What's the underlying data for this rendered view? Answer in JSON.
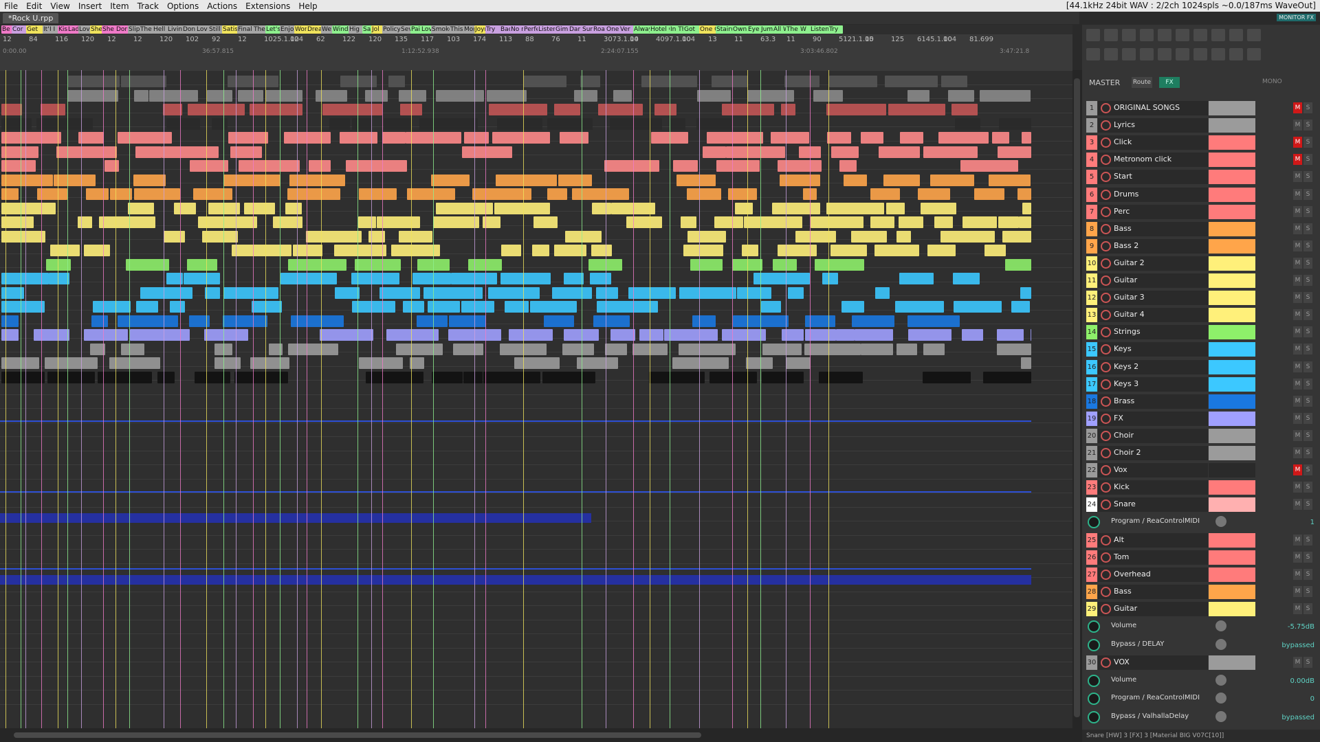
{
  "menu": {
    "items": [
      "File",
      "Edit",
      "View",
      "Insert",
      "Item",
      "Track",
      "Options",
      "Actions",
      "Extensions",
      "Help"
    ],
    "status": "[44.1kHz 24bit WAV : 2/2ch 1024spls ~0.0/187ms WaveOut]"
  },
  "project_tab": "*Rock U.rpp",
  "monitor_fx_label": "MONITOR FX",
  "master": {
    "label": "MASTER",
    "route": "Route",
    "fx": "FX",
    "mono": "MONO"
  },
  "regions": [
    {
      "label": "Be",
      "color": "#f07ac8"
    },
    {
      "label": "Cor",
      "color": "#c9a0e0"
    },
    {
      "label": "Get",
      "color": "#f0e35c"
    },
    {
      "label": "It's",
      "color": "#a6a6a6"
    },
    {
      "label": "I I",
      "color": "#a6a6a6"
    },
    {
      "label": "Kis",
      "color": "#f07ac8"
    },
    {
      "label": "Lad",
      "color": "#f07ac8"
    },
    {
      "label": "Lov",
      "color": "#a6a6a6"
    },
    {
      "label": "She",
      "color": "#f0e35c"
    },
    {
      "label": "She",
      "color": "#f07ac8"
    },
    {
      "label": "Dor",
      "color": "#f07ac8"
    },
    {
      "label": "Slip",
      "color": "#a6a6a6"
    },
    {
      "label": "The",
      "color": "#a6a6a6"
    },
    {
      "label": "Hell",
      "color": "#a6a6a6"
    },
    {
      "label": "Livin",
      "color": "#a6a6a6"
    },
    {
      "label": "Don't",
      "color": "#a6a6a6"
    },
    {
      "label": "Lov",
      "color": "#a6a6a6"
    },
    {
      "label": "Still",
      "color": "#a6a6a6"
    },
    {
      "label": "Satis",
      "color": "#f0e35c"
    },
    {
      "label": "Final",
      "color": "#a6a6a6"
    },
    {
      "label": "The",
      "color": "#a6a6a6"
    },
    {
      "label": "Let's",
      "color": "#8ef08e"
    },
    {
      "label": "Enjo",
      "color": "#a6a6a6"
    },
    {
      "label": "Won",
      "color": "#f0e35c"
    },
    {
      "label": "Drea",
      "color": "#f0e35c"
    },
    {
      "label": "We",
      "color": "#a6a6a6"
    },
    {
      "label": "Wind",
      "color": "#8ef08e"
    },
    {
      "label": "Hig",
      "color": "#a6a6a6"
    },
    {
      "label": "Sam",
      "color": "#8ef08e"
    },
    {
      "label": "Jol",
      "color": "#f0e35c"
    },
    {
      "label": "Policy",
      "color": "#a6a6a6"
    },
    {
      "label": "Sev",
      "color": "#a6a6a6"
    },
    {
      "label": "Pai",
      "color": "#8ef08e"
    },
    {
      "label": "Lov",
      "color": "#8ef08e"
    },
    {
      "label": "Smoke",
      "color": "#a6a6a6"
    },
    {
      "label": "This",
      "color": "#a6a6a6"
    },
    {
      "label": "Mon",
      "color": "#a6a6a6"
    },
    {
      "label": "Joyr",
      "color": "#f0e35c"
    },
    {
      "label": "Try",
      "color": "#c9a0e0"
    },
    {
      "label": "Bac",
      "color": "#c9a0e0"
    },
    {
      "label": "No r",
      "color": "#c9a0e0"
    },
    {
      "label": "Perfe",
      "color": "#c9a0e0"
    },
    {
      "label": "Listen",
      "color": "#c9a0e0"
    },
    {
      "label": "Gimm",
      "color": "#c9a0e0"
    },
    {
      "label": "Dar",
      "color": "#c9a0e0"
    },
    {
      "label": "Sun",
      "color": "#c9a0e0"
    },
    {
      "label": "Roa",
      "color": "#c9a0e0"
    },
    {
      "label": "One",
      "color": "#c9a0e0"
    },
    {
      "label": "Ver",
      "color": "#c9a0e0"
    },
    {
      "label": "Always",
      "color": "#8ef08e"
    },
    {
      "label": "Hotel C",
      "color": "#8ef08e"
    },
    {
      "label": "In Th",
      "color": "#8ef08e"
    },
    {
      "label": "Got",
      "color": "#8ef08e"
    },
    {
      "label": "One O",
      "color": "#f0e35c"
    },
    {
      "label": "Stairw",
      "color": "#8ef08e"
    },
    {
      "label": "Own",
      "color": "#8ef08e"
    },
    {
      "label": "Eye o",
      "color": "#8ef08e"
    },
    {
      "label": "Jum",
      "color": "#8ef08e"
    },
    {
      "label": "All W",
      "color": "#8ef08e"
    },
    {
      "label": "The",
      "color": "#8ef08e"
    },
    {
      "label": "W",
      "color": "#8ef08e"
    },
    {
      "label": "Listen",
      "color": "#8ef08e"
    },
    {
      "label": "Try",
      "color": "#8ef08e"
    }
  ],
  "ruler": {
    "ticks": [
      "12",
      "84",
      "116",
      "120",
      "12",
      "12",
      "120",
      "102",
      "92",
      "12",
      "1025.1.00",
      "124",
      "62",
      "122",
      "120",
      "135",
      "117",
      "103",
      "174",
      "113",
      "88",
      "76",
      "11",
      "3073.1.00",
      "14",
      "4097.1.00",
      "104",
      "13",
      "11",
      "63.3",
      "11",
      "90",
      "5121.1.00",
      "15",
      "125",
      "6145.1.00",
      "104",
      "81.699"
    ],
    "times": [
      "0:00.00",
      "36:57.815",
      "1:12:52.938",
      "2:24:07.155",
      "3:03:46.802",
      "3:47:21.8"
    ]
  },
  "tracks": [
    {
      "num": "1",
      "name": "ORIGINAL SONGS",
      "color": "#9b9b9b",
      "mute": true,
      "numbg": "#9b9b9b"
    },
    {
      "num": "2",
      "name": "Lyrics",
      "color": "#9b9b9b",
      "mute": false,
      "numbg": "#9b9b9b"
    },
    {
      "num": "3",
      "name": "Click",
      "color": "#ff7b7b",
      "mute": true,
      "numbg": "#ff7b7b"
    },
    {
      "num": "4",
      "name": "Metronom click",
      "color": "#ff7b7b",
      "mute": true,
      "numbg": "#ff7b7b"
    },
    {
      "num": "5",
      "name": "Start",
      "color": "#ff7b7b",
      "mute": false,
      "numbg": "#ff7b7b"
    },
    {
      "num": "6",
      "name": "Drums",
      "color": "#ff7b7b",
      "mute": false,
      "numbg": "#ff7b7b"
    },
    {
      "num": "7",
      "name": "Perc",
      "color": "#ff7b7b",
      "mute": false,
      "numbg": "#ff7b7b"
    },
    {
      "num": "8",
      "name": "Bass",
      "color": "#ffa54a",
      "mute": false,
      "numbg": "#ffa54a"
    },
    {
      "num": "9",
      "name": "Bass 2",
      "color": "#ffa54a",
      "mute": false,
      "numbg": "#ffa54a"
    },
    {
      "num": "10",
      "name": "Guitar 2",
      "color": "#fff07a",
      "mute": false,
      "numbg": "#fff07a"
    },
    {
      "num": "11",
      "name": "Guitar",
      "color": "#fff07a",
      "mute": false,
      "numbg": "#fff07a"
    },
    {
      "num": "12",
      "name": "Guitar 3",
      "color": "#fff07a",
      "mute": false,
      "numbg": "#fff07a"
    },
    {
      "num": "13",
      "name": "Guitar 4",
      "color": "#fff07a",
      "mute": false,
      "numbg": "#fff07a"
    },
    {
      "num": "14",
      "name": "Strings",
      "color": "#8ef06a",
      "mute": false,
      "numbg": "#8ef06a"
    },
    {
      "num": "15",
      "name": "Keys",
      "color": "#3cc8ff",
      "mute": false,
      "numbg": "#3cc8ff"
    },
    {
      "num": "16",
      "name": "Keys 2",
      "color": "#3cc8ff",
      "mute": false,
      "numbg": "#3cc8ff"
    },
    {
      "num": "17",
      "name": "Keys 3",
      "color": "#3cc8ff",
      "mute": false,
      "numbg": "#3cc8ff"
    },
    {
      "num": "18",
      "name": "Brass",
      "color": "#1a78e0",
      "mute": false,
      "numbg": "#1a78e0"
    },
    {
      "num": "19",
      "name": "FX",
      "color": "#a0a0ff",
      "mute": false,
      "numbg": "#a0a0ff"
    },
    {
      "num": "20",
      "name": "Choir",
      "color": "#9b9b9b",
      "mute": false,
      "numbg": "#9b9b9b"
    },
    {
      "num": "21",
      "name": "Choir 2",
      "color": "#9b9b9b",
      "mute": false,
      "numbg": "#9b9b9b"
    },
    {
      "num": "22",
      "name": "Vox",
      "color": "#2a2a2a",
      "mute": true,
      "numbg": "#9b9b9b"
    },
    {
      "num": "23",
      "name": "Kick",
      "color": "#ff7b7b",
      "mute": false,
      "numbg": "#ff7b7b"
    },
    {
      "num": "24",
      "name": "Snare",
      "color": "#ffb0b0",
      "mute": false,
      "numbg": "#ffffff"
    }
  ],
  "env1": {
    "label": "Program / ReaControlMIDI",
    "value": "1"
  },
  "tracks2": [
    {
      "num": "25",
      "name": "Alt",
      "color": "#ff7b7b",
      "numbg": "#ff7b7b"
    },
    {
      "num": "26",
      "name": "Tom",
      "color": "#ff7b7b",
      "numbg": "#ff7b7b"
    },
    {
      "num": "27",
      "name": "Overhead",
      "color": "#ff7b7b",
      "numbg": "#ff7b7b"
    },
    {
      "num": "28",
      "name": "Bass",
      "color": "#ffa54a",
      "numbg": "#ffa54a"
    },
    {
      "num": "29",
      "name": "Guitar",
      "color": "#fff07a",
      "numbg": "#fff07a"
    }
  ],
  "env2": [
    {
      "label": "Volume",
      "value": "-5.75dB"
    },
    {
      "label": "Bypass / DELAY",
      "value": "bypassed"
    }
  ],
  "track30": {
    "num": "30",
    "name": "VOX",
    "color": "#9b9b9b",
    "numbg": "#9b9b9b"
  },
  "env3": [
    {
      "label": "Volume",
      "value": "0.00dB"
    },
    {
      "label": "Program / ReaControlMIDI",
      "value": "0"
    },
    {
      "label": "Bypass / ValhallaDelay",
      "value": "bypassed"
    }
  ],
  "mute_letter": "M",
  "solo_letter": "S",
  "tcp_status": "Snare [HW] 3 [FX] 3 [Material BIG V07C[10]]"
}
